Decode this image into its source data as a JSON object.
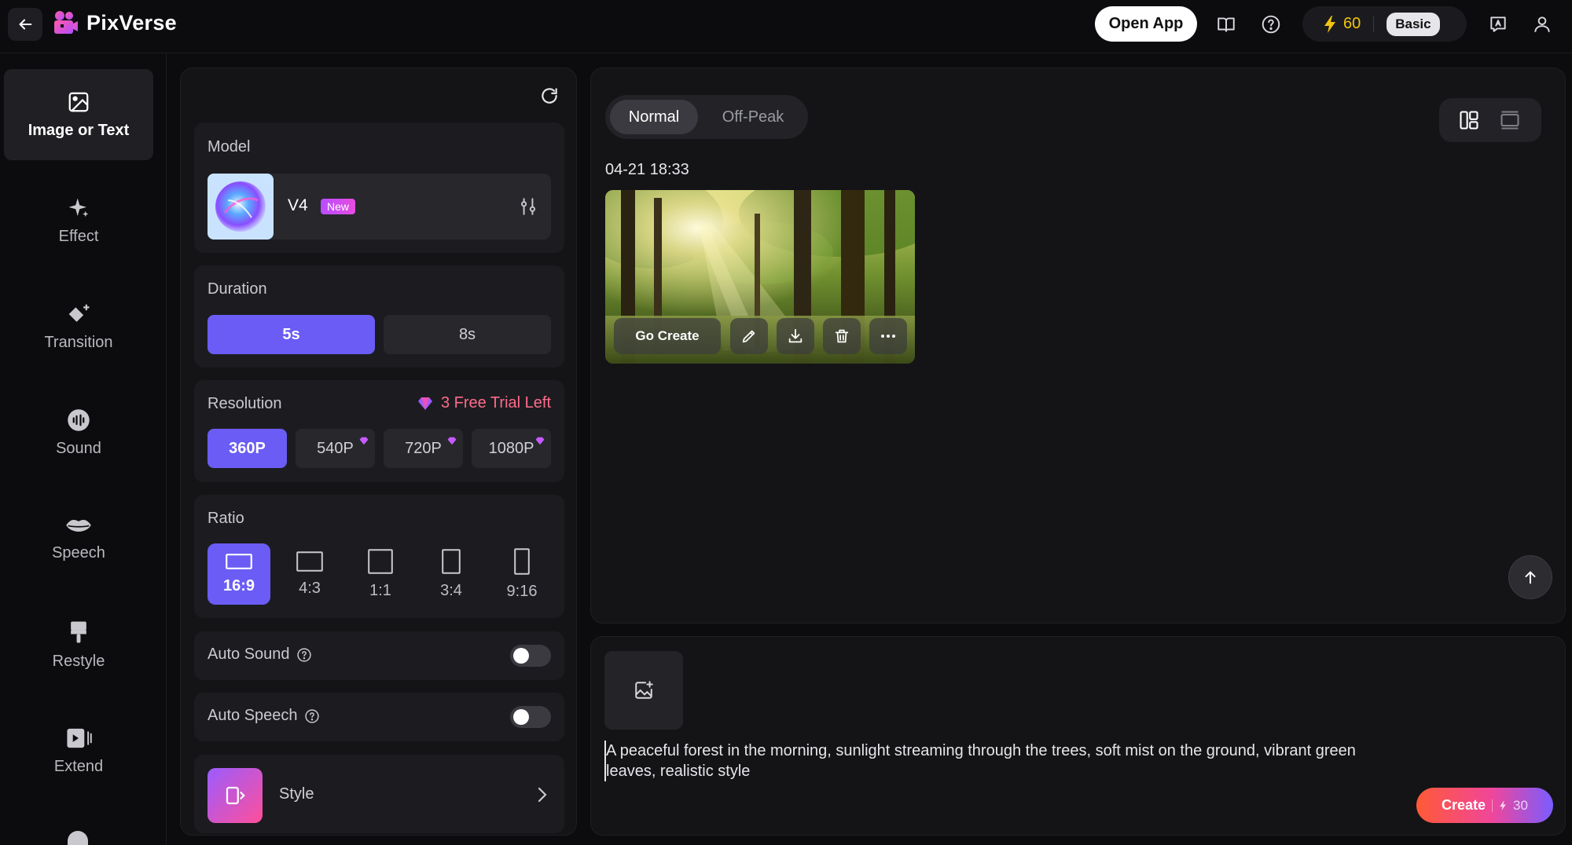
{
  "header": {
    "app_name": "PixVerse",
    "open_app_label": "Open App",
    "credits": "60",
    "plan": "Basic"
  },
  "sidebar": {
    "items": [
      {
        "label": "Image or Text",
        "icon": "image-icon",
        "active": true
      },
      {
        "label": "Effect",
        "icon": "sparkle-icon"
      },
      {
        "label": "Transition",
        "icon": "transition-icon"
      },
      {
        "label": "Sound",
        "icon": "soundwave-icon"
      },
      {
        "label": "Speech",
        "icon": "lips-icon"
      },
      {
        "label": "Restyle",
        "icon": "paintbrush-icon"
      },
      {
        "label": "Extend",
        "icon": "extend-icon"
      }
    ]
  },
  "settings": {
    "model_label": "Model",
    "model_name": "V4",
    "model_badge": "New",
    "duration_label": "Duration",
    "durations": [
      "5s",
      "8s"
    ],
    "duration_selected": "5s",
    "resolution_label": "Resolution",
    "trial_text": "3 Free Trial Left",
    "resolutions": [
      "360P",
      "540P",
      "720P",
      "1080P"
    ],
    "resolution_selected": "360P",
    "ratio_label": "Ratio",
    "ratios": [
      "16:9",
      "4:3",
      "1:1",
      "3:4",
      "9:16"
    ],
    "ratio_selected": "16:9",
    "auto_sound_label": "Auto Sound",
    "auto_sound_on": false,
    "auto_speech_label": "Auto Speech",
    "auto_speech_on": false,
    "style_label": "Style"
  },
  "results": {
    "tabs": [
      "Normal",
      "Off-Peak"
    ],
    "tab_selected": "Normal",
    "timestamp": "04-21 18:33",
    "go_create_label": "Go Create"
  },
  "prompt": {
    "text": "A peaceful forest in the morning, sunlight streaming through the trees, soft mist on the ground, vibrant green leaves, realistic style",
    "create_label": "Create",
    "create_cost": "30"
  },
  "colors": {
    "accent": "#6a5cf5",
    "credit": "#f1c40f",
    "trial": "#ff6b8b"
  }
}
